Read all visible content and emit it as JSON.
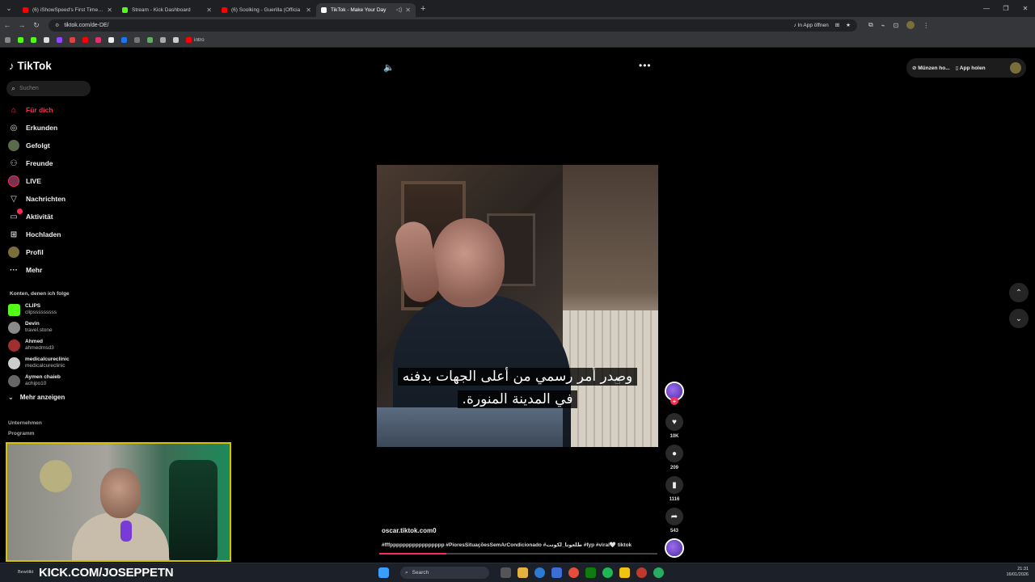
{
  "browser": {
    "tabs": [
      {
        "title": "(6) iShowSpeed's First Time In I",
        "color": "#ff0000",
        "active": false
      },
      {
        "title": "Stream - Kick Dashboard",
        "color": "#53fc18",
        "active": false
      },
      {
        "title": "(6) Soolking - Guerilla (Officia",
        "color": "#ff0000",
        "active": false
      },
      {
        "title": "TikTok - Make Your Day",
        "color": "#ffffff",
        "active": true
      }
    ],
    "url": "tiktok.com/de-DE/",
    "open_in_app": "In App öffnen",
    "bookmark_intro": "intro"
  },
  "tiktok": {
    "logo": "TikTok",
    "search_placeholder": "Suchen",
    "nav": [
      {
        "label": "Für dich",
        "icon": "home-icon"
      },
      {
        "label": "Erkunden",
        "icon": "compass-icon"
      },
      {
        "label": "Gefolgt",
        "icon": "following-icon"
      },
      {
        "label": "Freunde",
        "icon": "friends-icon"
      },
      {
        "label": "LIVE",
        "icon": "live-icon"
      },
      {
        "label": "Nachrichten",
        "icon": "messages-icon"
      },
      {
        "label": "Aktivität",
        "icon": "inbox-icon"
      },
      {
        "label": "Hochladen",
        "icon": "upload-icon"
      },
      {
        "label": "Profil",
        "icon": "profile-icon"
      },
      {
        "label": "Mehr",
        "icon": "more-icon"
      }
    ],
    "following_header": "Konten, denen ich folge",
    "accounts": [
      {
        "name": "CLIPS",
        "handle": "clipsssssssss",
        "color": "#53fc18"
      },
      {
        "name": "Devin",
        "handle": "travel.stone",
        "color": "#8a8a8a"
      },
      {
        "name": "Ahmed",
        "handle": "ahmedmsd3",
        "color": "#a03030"
      },
      {
        "name": "medicalcureclinic",
        "handle": "medicalcureclinic",
        "color": "#cccccc"
      },
      {
        "name": "Aymen chaieb",
        "handle": "achipo10",
        "color": "#666666"
      }
    ],
    "show_more": "Mehr anzeigen",
    "footer": [
      "Unternehmen",
      "Programm"
    ],
    "top_right": {
      "coins": "Münzen ho...",
      "get_app": "App holen"
    },
    "subtitle_lines": [
      "وصدر أمر رسمي من أعلى الجهات بدفنه",
      "في المدينة المنورة."
    ],
    "actions": {
      "likes": "10K",
      "comments": "209",
      "saves": "1116",
      "shares": "543"
    },
    "caption_user": "oscar.tiktok.com0",
    "caption_tags": "#fffppppppppppppppppp #PioresSituaçõesSemArCondicionado #طلعونا_لكونت #fyp #viral🤍 tiktok",
    "progress": 0.24
  },
  "stream_overlay": {
    "kick_url": "KICK.COM/JOSEPPETN"
  },
  "taskbar": {
    "search": "Search",
    "time": "21:31",
    "date": "16/01/2026",
    "weather": "Bewölkt"
  }
}
